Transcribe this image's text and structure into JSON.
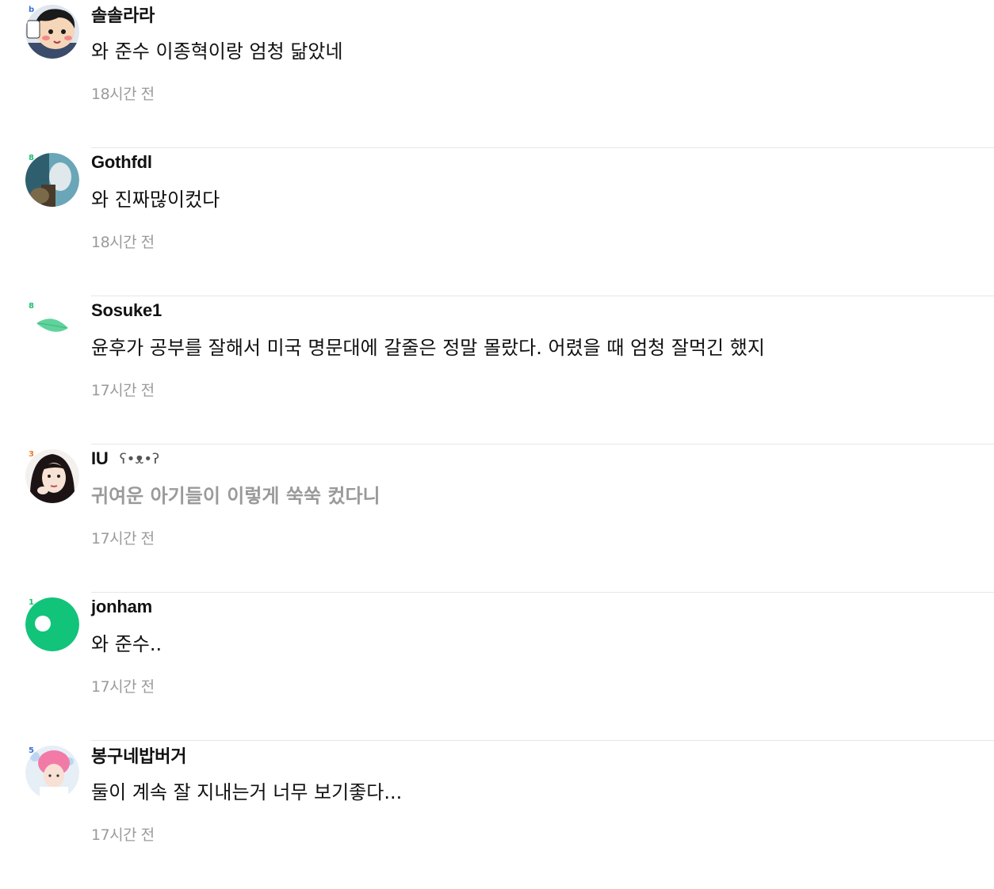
{
  "comments": [
    {
      "name": "솔솔라라",
      "emoticon": "",
      "text": "와 준수 이종혁이랑 엄청 닮았네",
      "time": "18시간 전",
      "avatar_icon": "cartoon-boy-avatar",
      "badge": "b",
      "badge_color": "#3a6fd8",
      "faded": false
    },
    {
      "name": "Gothfdl",
      "emoticon": "",
      "text": "와 진짜많이컸다",
      "time": "18시간 전",
      "avatar_icon": "photo-avatar",
      "badge": "8",
      "badge_color": "#1fbf6f",
      "faded": false
    },
    {
      "name": "Sosuke1",
      "emoticon": "",
      "text": "윤후가 공부를 잘해서 미국 명문대에 갈줄은 정말 몰랐다. 어렸을 때 엄청 잘먹긴 했지",
      "time": "17시간 전",
      "avatar_icon": "leaf-avatar",
      "badge": "8",
      "badge_color": "#1fbf6f",
      "faded": false
    },
    {
      "name": "IU",
      "emoticon": "ʕ•ᴥ•ʔ",
      "text": "귀여운 아기들이 이렇게 쑥쑥 컸다니",
      "time": "17시간 전",
      "avatar_icon": "woman-portrait-avatar",
      "badge": "3",
      "badge_color": "#f07a2a",
      "faded": true
    },
    {
      "name": "jonham",
      "emoticon": "",
      "text": "와 준수..",
      "time": "17시간 전",
      "avatar_icon": "green-circle-avatar",
      "badge": "1",
      "badge_color": "#1fbf6f",
      "faded": false
    },
    {
      "name": "봉구네밥버거",
      "emoticon": "",
      "text": "둘이 계속 잘 지내는거 너무 보기좋다...",
      "time": "17시간 전",
      "avatar_icon": "pink-hair-avatar",
      "badge": "5",
      "badge_color": "#3a6fd8",
      "faded": false
    }
  ],
  "colors": {
    "text": "#111111",
    "muted": "#9a9a9a",
    "divider": "#e6e6e6",
    "accent_green": "#1fbf6f"
  }
}
